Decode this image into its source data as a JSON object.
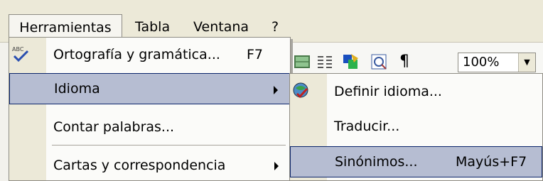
{
  "menubar": {
    "herramientas": "Herramientas",
    "tabla": "Tabla",
    "ventana": "Ventana",
    "help": "?"
  },
  "toolbar": {
    "zoom_value": "100%",
    "icons": [
      "table-icon",
      "columns-icon",
      "drawing-icon",
      "document-map-icon",
      "show-formatting-icon"
    ]
  },
  "tools_menu": {
    "items": [
      {
        "label": "Ortografía y gramática...",
        "shortcut": "F7",
        "icon": "spelling-check-icon"
      },
      {
        "label": "Idioma",
        "has_submenu": true,
        "highlighted": true
      },
      {
        "label": "Contar palabras..."
      },
      {
        "label": "Cartas y correspondencia",
        "has_submenu": true
      }
    ]
  },
  "language_submenu": {
    "items": [
      {
        "label": "Definir idioma...",
        "icon": "globe-check-icon"
      },
      {
        "label": "Traducir..."
      },
      {
        "label": "Sinónimos...",
        "shortcut": "Mayús+F7",
        "highlighted": true
      }
    ]
  },
  "colors": {
    "menu_bg": "#fbfbf9",
    "highlight": "#b6bdd2",
    "highlight_border": "#0a246a",
    "chrome": "#ece9d8"
  }
}
